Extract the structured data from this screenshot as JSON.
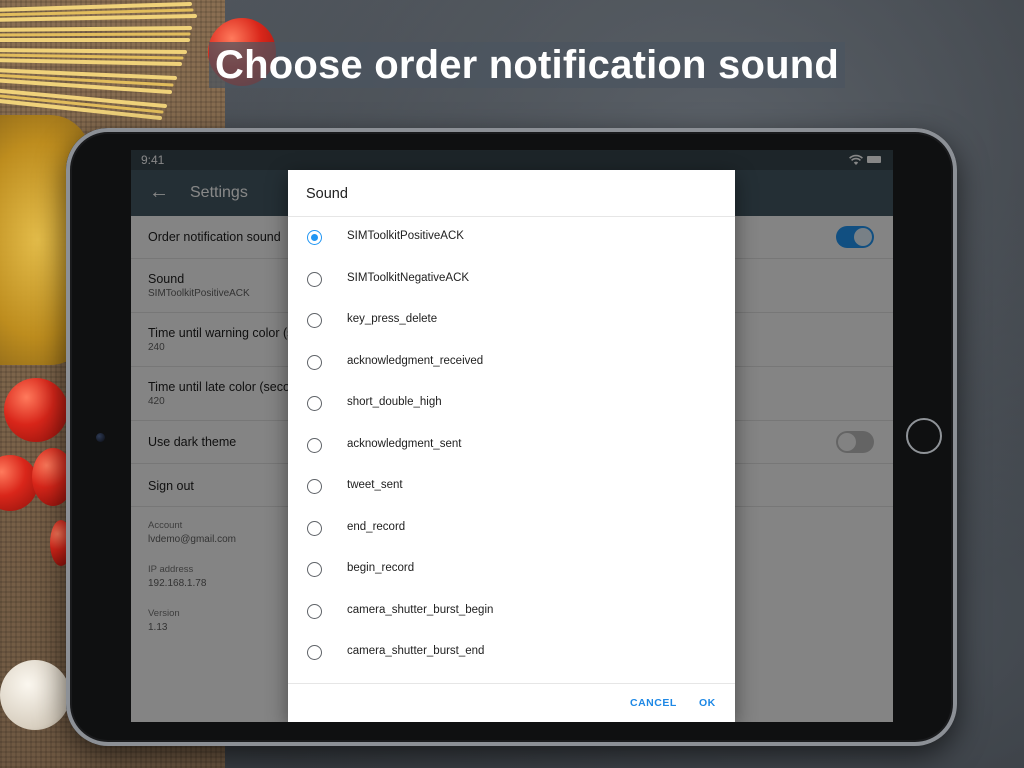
{
  "headline": "Choose order notification sound",
  "status_bar": {
    "time": "9:41",
    "wifi_icon": "wifi-icon",
    "battery_icon": "battery-icon"
  },
  "app_bar": {
    "back_icon": "arrow-left-icon",
    "back_glyph": "←",
    "title": "Settings"
  },
  "settings": {
    "order_notification_sound": {
      "label": "Order notification sound",
      "enabled": true
    },
    "sound": {
      "label": "Sound",
      "value": "SIMToolkitPositiveACK"
    },
    "warning_color": {
      "label": "Time until warning color (s",
      "value": "240"
    },
    "late_color": {
      "label": "Time until late color (secor",
      "value": "420"
    },
    "dark_theme": {
      "label": "Use dark theme",
      "enabled": false
    },
    "sign_out": {
      "label": "Sign out"
    },
    "account": {
      "label": "Account",
      "value": "lvdemo@gmail.com"
    },
    "ip_address": {
      "label": "IP address",
      "value": "192.168.1.78"
    },
    "version": {
      "label": "Version",
      "value": "1.13"
    }
  },
  "dialog": {
    "title": "Sound",
    "selected_index": 0,
    "options": [
      "SIMToolkitPositiveACK",
      "SIMToolkitNegativeACK",
      "key_press_delete",
      "acknowledgment_received",
      "short_double_high",
      "acknowledgment_sent",
      "tweet_sent",
      "end_record",
      "begin_record",
      "camera_shutter_burst_begin",
      "camera_shutter_burst_end"
    ],
    "cancel_label": "CANCEL",
    "ok_label": "OK"
  },
  "colors": {
    "accent": "#2196f3",
    "app_bar": "#455a64",
    "status_bar": "#37474f"
  }
}
